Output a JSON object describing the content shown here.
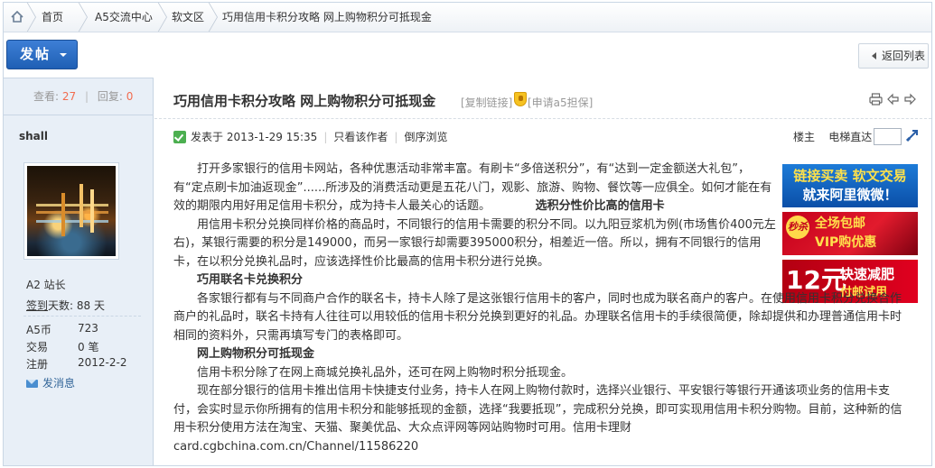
{
  "breadcrumb": {
    "items": [
      "首页",
      "A5交流中心",
      "软文区",
      "巧用信用卡积分攻略 网上购物积分可抵现金"
    ]
  },
  "toolbar": {
    "post_label": "发帖",
    "back_label": "返回列表"
  },
  "stats": {
    "views_label": "查看:",
    "views": "27",
    "replies_label": "回复:",
    "replies": "0"
  },
  "author": {
    "name": "shall",
    "rank": "A2 站长",
    "signin_label": "签到",
    "signin_rest": "天数: 88 天",
    "fields": [
      {
        "label": "A5币",
        "value": "723"
      },
      {
        "label": "交易",
        "value": "0 笔"
      },
      {
        "label": "注册",
        "value": "2012-2-2"
      }
    ],
    "message_label": "发消息"
  },
  "thread": {
    "title": "巧用信用卡积分攻略 网上购物积分可抵现金",
    "copy_link": "[复制链接]",
    "apply_a5": "[申请a5担保]",
    "posted": "发表于 2013-1-29 15:35",
    "only_author": "只看该作者",
    "reverse": "倒序浏览",
    "floor": "楼主",
    "jump_label": "电梯直达"
  },
  "post": {
    "p1": "打开多家银行的信用卡网站，各种优惠活动非常丰富。有刷卡“多倍送积分”，有“达到一定金额送大礼包”，有“定点刷卡加油返现金”......所涉及的消费活动更是五花八门，观影、旅游、购物、餐饮等一应俱全。如何才能在有效的期限内用好用足信用卡积分，成为持卡人最关心的话题。",
    "h1": "选积分性价比高的信用卡",
    "p2": "用信用卡积分兑换同样价格的商品时，不同银行的信用卡需要的积分不同。以九阳豆浆机为例(市场售价400元左右)，某银行需要的积分是149000，而另一家银行却需要395000积分，相差近一倍。所以，拥有不同银行的信用卡，在以积分兑换礼品时，应该选择性价比最高的信用卡积分进行兑换。",
    "h2": "巧用联名卡兑换积分",
    "p3": "各家银行都有与不同商户合作的联名卡，持卡人除了是这张银行信用卡的客户，同时也成为联名商户的客户。在使用信用卡积分兑换合作商户的礼品时，联名卡持有人往往可以用较低的信用卡积分兑换到更好的礼品。办理联名信用卡的手续很简便，除却提供和办理普通信用卡时相同的资料外，只需再填写专门的表格即可。",
    "h3": "网上购物积分可抵现金",
    "p4": "信用卡积分除了在网上商城兑换礼品外，还可在网上购物时积分抵现金。",
    "p5": "现在部分银行的信用卡推出信用卡快捷支付业务，持卡人在网上购物付款时，选择兴业银行、平安银行等银行开通该项业务的信用卡支付，会实时显示你所拥有的信用卡积分和能够抵现的金额，选择“我要抵现”，完成积分兑换，即可实现用信用卡积分购物。目前，这种新的信用卡积分使用方法在淘宝、天猫、聚美优品、大众点评网等网站购物时可用。信用卡理财",
    "p6": "card.cgbchina.com.cn/Channel/11586220"
  },
  "ads": {
    "a1_l1": "链接买卖",
    "a1_l1b": "软文交易",
    "a1_l2": "就来阿里微微！",
    "a2_badge": "秒杀",
    "a2_l1": "全场包邮",
    "a2_l2": "VIP购优惠",
    "a3_big": "12元",
    "a3_l1": "快速减肥",
    "a3_l2": "付邮试用"
  }
}
